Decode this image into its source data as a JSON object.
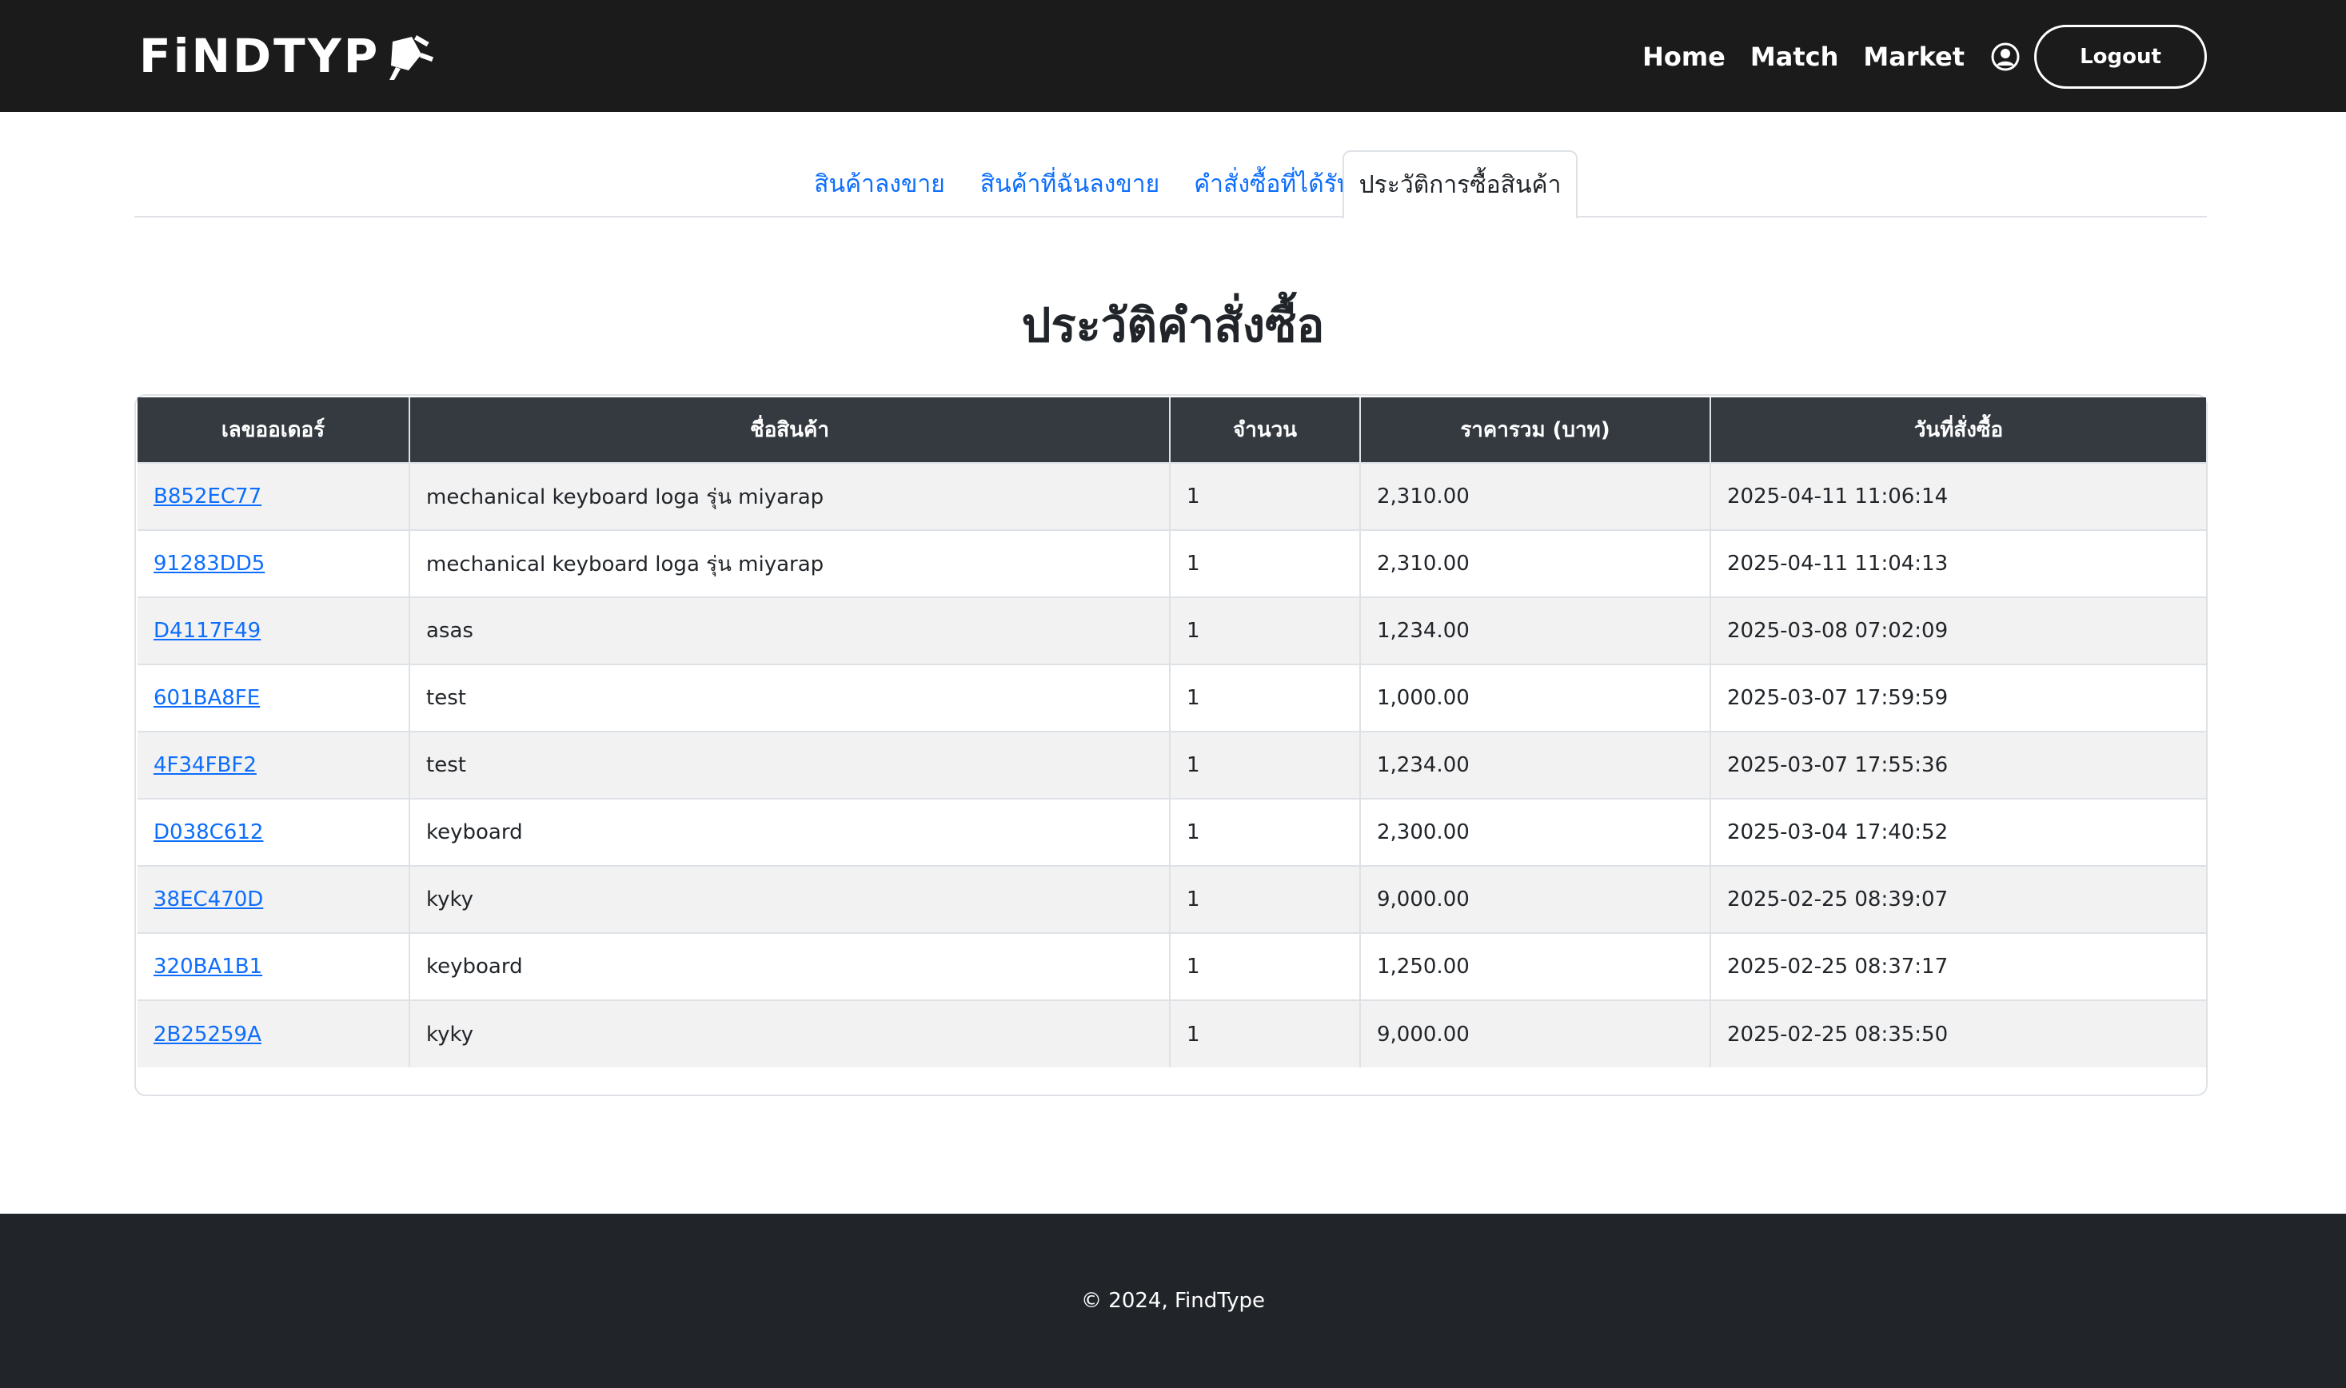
{
  "navbar": {
    "brand": "FiNDTYP",
    "links": [
      "Home",
      "Match",
      "Market"
    ],
    "logout_label": "Logout",
    "user_icon": "user-circle-icon",
    "brand_icon": "plug-icon"
  },
  "tabs": [
    {
      "label": "สินค้าลงขาย",
      "active": false
    },
    {
      "label": "สินค้าที่ฉันลงขาย",
      "active": false
    },
    {
      "label": "คำสั่งซื้อที่ได้รับ",
      "active": false
    },
    {
      "label": "ประวัติการซื้อสินค้า",
      "active": true
    }
  ],
  "page_title": "ประวัติคำสั่งซื้อ",
  "table": {
    "headers": [
      "เลขออเดอร์",
      "ชื่อสินค้า",
      "จำนวน",
      "ราคารวม (บาท)",
      "วันที่สั่งซื้อ"
    ],
    "rows": [
      {
        "order_id": "B852EC77",
        "product": "mechanical keyboard loga รุ่น miyarap",
        "qty": "1",
        "total": "2,310.00",
        "date": "2025-04-11 11:06:14"
      },
      {
        "order_id": "91283DD5",
        "product": "mechanical keyboard loga รุ่น miyarap",
        "qty": "1",
        "total": "2,310.00",
        "date": "2025-04-11 11:04:13"
      },
      {
        "order_id": "D4117F49",
        "product": "asas",
        "qty": "1",
        "total": "1,234.00",
        "date": "2025-03-08 07:02:09"
      },
      {
        "order_id": "601BA8FE",
        "product": "test",
        "qty": "1",
        "total": "1,000.00",
        "date": "2025-03-07 17:59:59"
      },
      {
        "order_id": "4F34FBF2",
        "product": "test",
        "qty": "1",
        "total": "1,234.00",
        "date": "2025-03-07 17:55:36"
      },
      {
        "order_id": "D038C612",
        "product": "keyboard",
        "qty": "1",
        "total": "2,300.00",
        "date": "2025-03-04 17:40:52"
      },
      {
        "order_id": "38EC470D",
        "product": "kyky",
        "qty": "1",
        "total": "9,000.00",
        "date": "2025-02-25 08:39:07"
      },
      {
        "order_id": "320BA1B1",
        "product": "keyboard",
        "qty": "1",
        "total": "1,250.00",
        "date": "2025-02-25 08:37:17"
      },
      {
        "order_id": "2B25259A",
        "product": "kyky",
        "qty": "1",
        "total": "9,000.00",
        "date": "2025-02-25 08:35:50"
      }
    ]
  },
  "footer": {
    "text": "© 2024, FindType"
  },
  "colors": {
    "navbar_bg": "#1b1b1b",
    "footer_bg": "#212529",
    "table_header_bg": "#343a40",
    "link": "#0d6efd",
    "striped_row": "#f2f2f2"
  }
}
